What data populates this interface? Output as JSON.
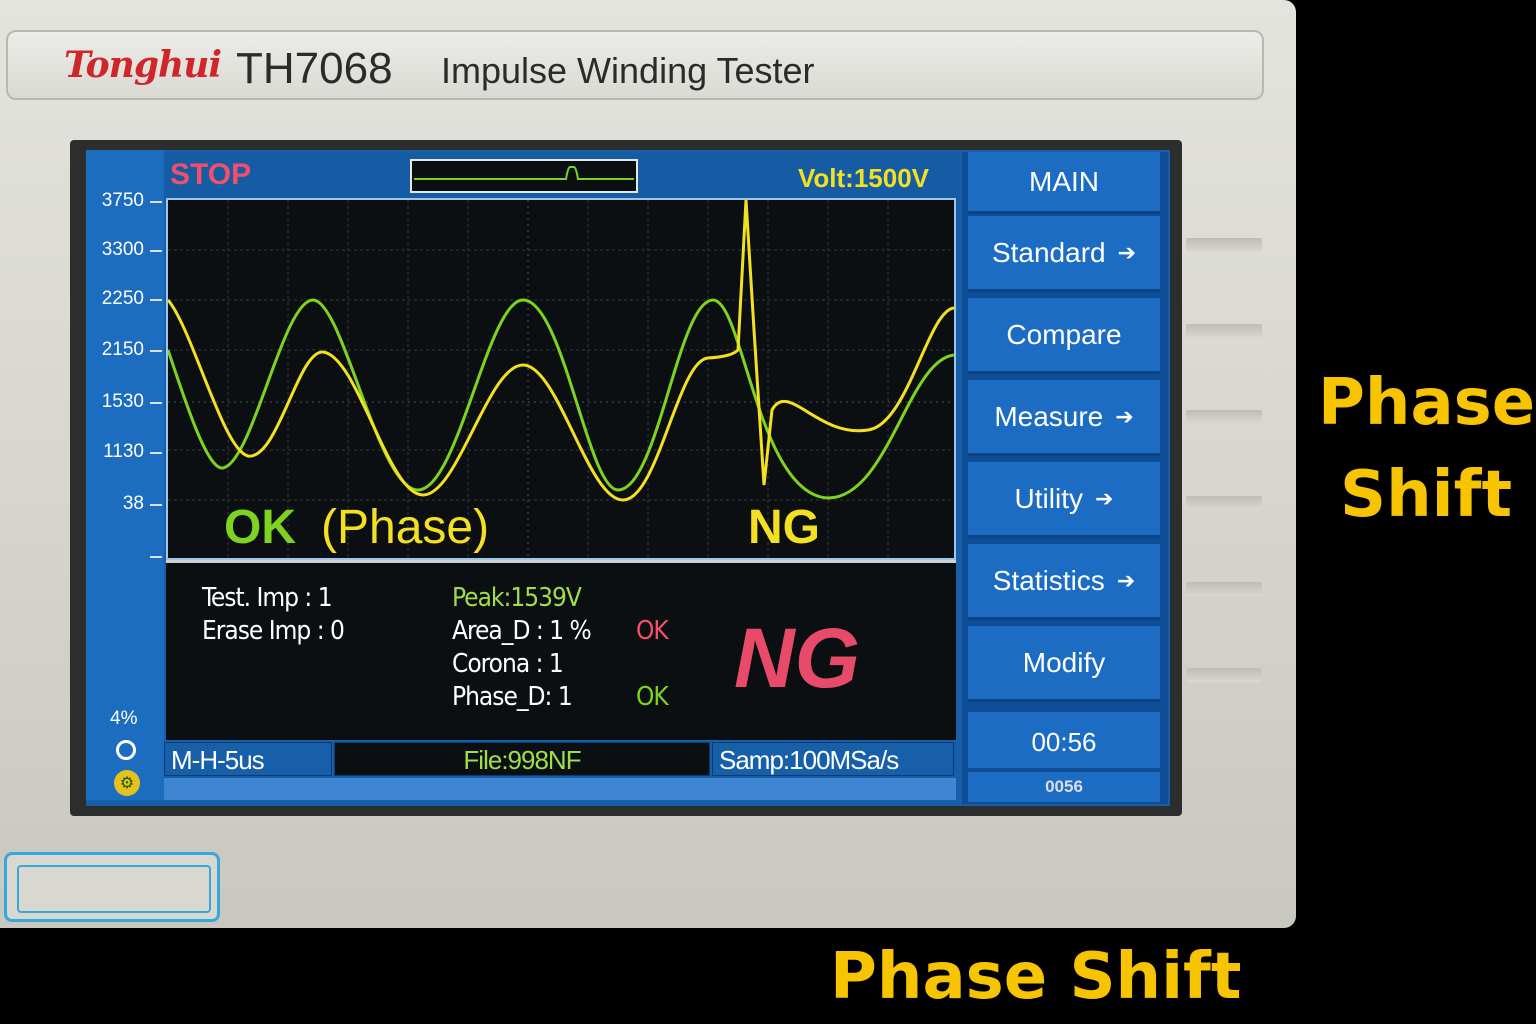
{
  "device": {
    "brand": "Tonghui",
    "model": "TH7068",
    "product": "Impulse Winding Tester"
  },
  "screen": {
    "state": "STOP",
    "voltage": "Volt:1500V",
    "y_axis_labels": [
      "3750",
      "3300",
      "2250",
      "2150",
      "1530",
      "1130",
      "38"
    ],
    "rail_percent": "4%",
    "wave_labels": {
      "ok": "OK",
      "phase": "(Phase)",
      "ng": "NG"
    },
    "info": {
      "test_imp": "Test. Imp : 1",
      "erase_imp": "Erase Imp : 0",
      "peak": "Peak:1539V",
      "area_d": "Area_D :   1 %",
      "area_d_result": "OK",
      "corona": "Corona :   1",
      "phase_d": "Phase_D:  1",
      "phase_d_result": "OK",
      "verdict": "NG"
    },
    "status_bar": {
      "mode": "M-H-5us",
      "file": "File:998NF",
      "sample_rate": "Samp:100MSa/s"
    },
    "menu": {
      "title": "MAIN",
      "items": [
        {
          "label": "Standard",
          "arrow": true
        },
        {
          "label": "Compare",
          "arrow": false
        },
        {
          "label": "Measure",
          "arrow": true
        },
        {
          "label": "Utility",
          "arrow": true
        },
        {
          "label": "Statistics",
          "arrow": true
        },
        {
          "label": "Modify",
          "arrow": false
        }
      ],
      "time": "00:56",
      "counter": "0056"
    }
  },
  "captions": {
    "right_line1": "Phase",
    "right_line2": "Shift",
    "bottom": "Phase Shift"
  },
  "colors": {
    "ok_wave": "#7ed321",
    "ng_wave": "#f3e020",
    "verdict": "#e84a6a",
    "caption": "#f6c400"
  }
}
